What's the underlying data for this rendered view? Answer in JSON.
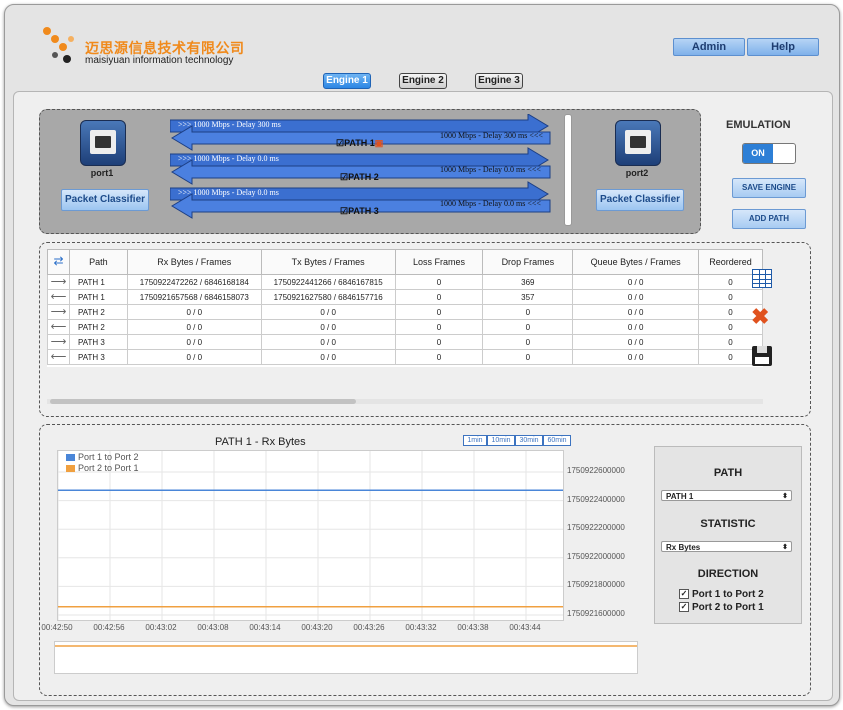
{
  "header": {
    "logo_cn": "迈思源信息技术有限公司",
    "logo_en": "maisiyuan information technology",
    "admin_label": "Admin",
    "help_label": "Help"
  },
  "tabs": [
    {
      "label": "Engine 1",
      "active": true
    },
    {
      "label": "Engine 2",
      "active": false
    },
    {
      "label": "Engine 3",
      "active": false
    }
  ],
  "topology": {
    "port1_label": "port1",
    "port2_label": "port2",
    "classifier_label": "Packet Classifier",
    "paths": [
      {
        "name": "PATH 1",
        "forward": "1000 Mbps - Delay 300 ms",
        "reverse": "1000 Mbps - Delay 300 ms"
      },
      {
        "name": "PATH 2",
        "forward": "1000 Mbps - Delay 0.0 ms",
        "reverse": "1000 Mbps - Delay 0.0 ms"
      },
      {
        "name": "PATH 3",
        "forward": "1000 Mbps - Delay 0.0 ms",
        "reverse": "1000 Mbps - Delay 0.0 ms"
      }
    ]
  },
  "emulation": {
    "title": "EMULATION",
    "toggle_label": "ON",
    "save_engine_label": "SAVE ENGINE",
    "add_path_label": "ADD PATH"
  },
  "stats_table": {
    "columns": [
      "Path",
      "Rx Bytes / Frames",
      "Tx Bytes / Frames",
      "Loss Frames",
      "Drop Frames",
      "Queue Bytes / Frames",
      "Reordered"
    ],
    "rows": [
      {
        "dir": "right",
        "cells": [
          "PATH 1",
          "1750922472262 / 6846168184",
          "1750922441266 / 6846167815",
          "0",
          "369",
          "0 / 0",
          "0"
        ]
      },
      {
        "dir": "left",
        "cells": [
          "PATH 1",
          "1750921657568 / 6846158073",
          "1750921627580 / 6846157716",
          "0",
          "357",
          "0 / 0",
          "0"
        ]
      },
      {
        "dir": "right",
        "cells": [
          "PATH 2",
          "0 / 0",
          "0 / 0",
          "0",
          "0",
          "0 / 0",
          "0"
        ]
      },
      {
        "dir": "left",
        "cells": [
          "PATH 2",
          "0 / 0",
          "0 / 0",
          "0",
          "0",
          "0 / 0",
          "0"
        ]
      },
      {
        "dir": "right",
        "cells": [
          "PATH 3",
          "0 / 0",
          "0 / 0",
          "0",
          "0",
          "0 / 0",
          "0"
        ]
      },
      {
        "dir": "left",
        "cells": [
          "PATH 3",
          "0 / 0",
          "0 / 0",
          "0",
          "0",
          "0 / 0",
          "0"
        ]
      }
    ]
  },
  "chart_controls": {
    "ranges": [
      "1min",
      "10min",
      "30min",
      "60min"
    ],
    "path_title": "PATH",
    "path_value": "PATH 1",
    "statistic_title": "STATISTIC",
    "statistic_value": "Rx Bytes",
    "direction_title": "DIRECTION",
    "dir1_label": "Port 1 to Port 2",
    "dir2_label": "Port 2 to Port 1"
  },
  "chart_data": {
    "type": "line",
    "title": "PATH 1 - Rx Bytes",
    "xlabel": "",
    "ylabel": "",
    "x": [
      "00:42:50",
      "00:42:56",
      "00:43:02",
      "00:43:08",
      "00:43:14",
      "00:43:20",
      "00:43:26",
      "00:43:32",
      "00:43:38",
      "00:43:44"
    ],
    "yticks": [
      "1750922600000",
      "1750922400000",
      "1750922200000",
      "1750922000000",
      "1750921800000",
      "1750921600000"
    ],
    "ylim": [
      1750921600000,
      1750922600000
    ],
    "series": [
      {
        "name": "Port 1 to Port 2",
        "color": "#4a86d8",
        "values": [
          1750922472262,
          1750922472262,
          1750922472262,
          1750922472262,
          1750922472262,
          1750922472262,
          1750922472262,
          1750922472262,
          1750922472262,
          1750922472262
        ]
      },
      {
        "name": "Port 2 to Port 1",
        "color": "#f0a040",
        "values": [
          1750921657568,
          1750921657568,
          1750921657568,
          1750921657568,
          1750921657568,
          1750921657568,
          1750921657568,
          1750921657568,
          1750921657568,
          1750921657568
        ]
      }
    ],
    "legend": "top-left",
    "grid": true
  },
  "colors": {
    "accent": "#2d7fd6",
    "logo_orange": "#f08a1c",
    "delete_red": "#e0521e"
  }
}
